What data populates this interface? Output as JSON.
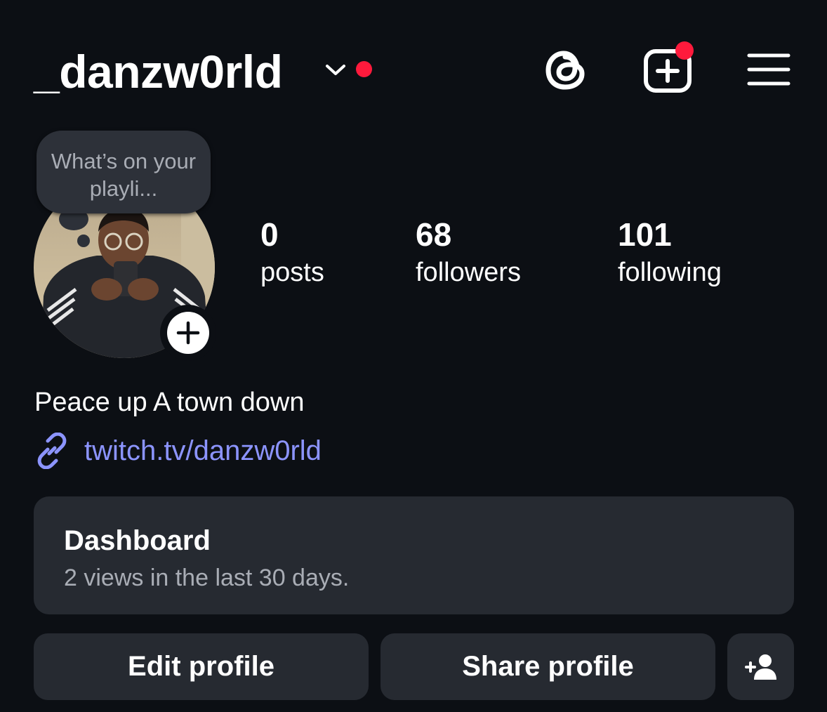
{
  "header": {
    "username": "_danzw0rld",
    "accent_red": "#ff1a3c"
  },
  "note": {
    "text": "What’s on your playli..."
  },
  "stats": [
    {
      "value": "0",
      "label": "posts"
    },
    {
      "value": "68",
      "label": "followers"
    },
    {
      "value": "101",
      "label": "following"
    }
  ],
  "bio": {
    "text": "Peace up A town down",
    "link": "twitch.tv/danzw0rld",
    "link_color": "#8c94ff"
  },
  "dashboard": {
    "title": "Dashboard",
    "subtitle": "2 views in the last 30 days."
  },
  "buttons": {
    "edit": "Edit profile",
    "share": "Share profile"
  },
  "icons": {
    "threads": "threads-icon",
    "create": "plus-square-icon",
    "menu": "hamburger-menu-icon",
    "link": "link-icon",
    "add_person": "add-person-icon"
  }
}
